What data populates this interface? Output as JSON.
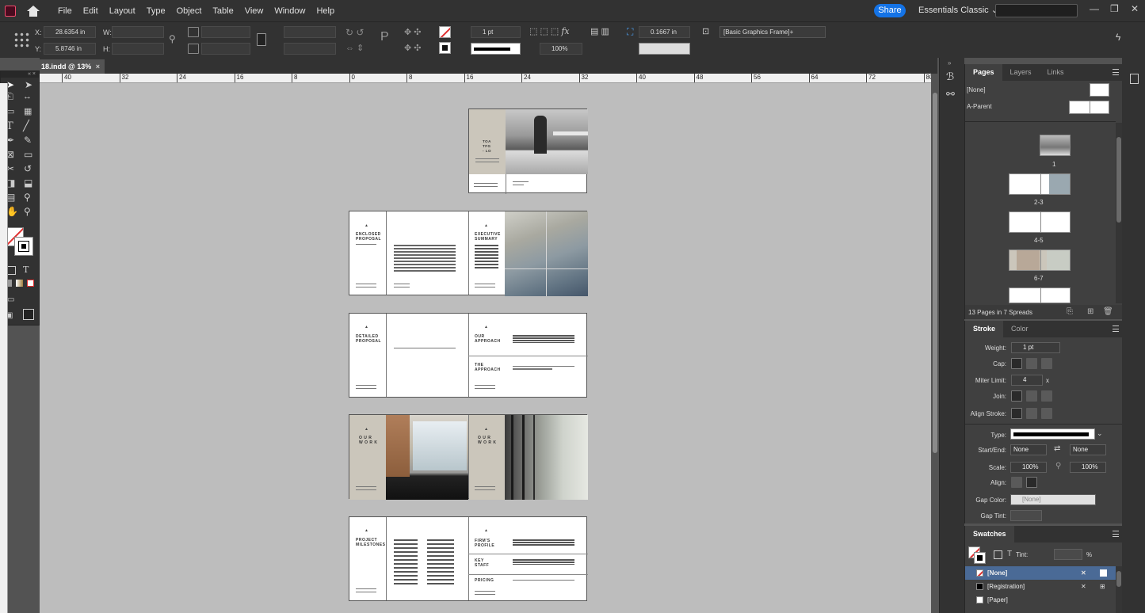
{
  "app": {
    "menu": [
      "File",
      "Edit",
      "Layout",
      "Type",
      "Object",
      "Table",
      "View",
      "Window",
      "Help"
    ],
    "share_label": "Share",
    "workspace_label": "Essentials Classic",
    "window_controls": [
      "—",
      "❐",
      "✕"
    ]
  },
  "control_panel": {
    "x_label": "X:",
    "x_value": "28.6354 in",
    "y_label": "Y:",
    "y_value": "5.8746 in",
    "w_label": "W:",
    "h_label": "H:",
    "stroke_weight": "1 pt",
    "scale_value": "100%",
    "offset_value": "0.1667 in",
    "object_style": "[Basic Graphics Frame]+"
  },
  "document": {
    "tab_label": "18.indd @ 13%",
    "tab_close": "×",
    "ruler_ticks": [
      "40",
      "32",
      "24",
      "16",
      "8",
      "0",
      "8",
      "16",
      "24",
      "32",
      "40",
      "48",
      "56",
      "64",
      "72",
      "80"
    ]
  },
  "spreads": {
    "cover_text": "TOA\nTFG\n- LO",
    "enclosed_proposal": "ENCLOSED\nPROPOSAL",
    "executive_summary": "EXECUTIVE\nSUMMARY",
    "detailed_proposal": "DETAILED\nPROPOSAL",
    "our_approach": "OUR\nAPPROACH",
    "the_approach": "THE\nAPPROACH",
    "our_work_left": "O U R\nW O R K",
    "our_work_right": "O U R\nW O R K",
    "project_milestones": "PROJECT\nMILESTONES",
    "firms_profile": "FIRM'S\nPROFILE",
    "key_staff": "KEY\nSTAFF",
    "pricing": "PRICING"
  },
  "pages_panel": {
    "tabs": [
      "Pages",
      "Layers",
      "Links"
    ],
    "none_label": "[None]",
    "parent_label": "A-Parent",
    "thumb_labels": [
      "1",
      "2-3",
      "4-5",
      "6-7"
    ],
    "footer": "13 Pages in 7 Spreads"
  },
  "stroke_panel": {
    "tabs": [
      "Stroke",
      "Color"
    ],
    "weight_label": "Weight:",
    "weight_value": "1 pt",
    "cap_label": "Cap:",
    "miter_label": "Miter Limit:",
    "miter_value": "4",
    "miter_unit": "x",
    "join_label": "Join:",
    "align_stroke_label": "Align Stroke:",
    "type_label": "Type:",
    "start_end_label": "Start/End:",
    "start_value": "None",
    "end_value": "None",
    "scale_label": "Scale:",
    "scale_start": "100%",
    "scale_end": "100%",
    "align_label": "Align:",
    "gap_color_label": "Gap Color:",
    "gap_color_value": "[None]",
    "gap_tint_label": "Gap Tint:"
  },
  "swatches_panel": {
    "title": "Swatches",
    "tint_label": "Tint:",
    "tint_unit": "%",
    "text_icon": "T",
    "items": [
      "[None]",
      "[Registration]",
      "[Paper]"
    ]
  },
  "colors": {
    "accent": "#1473e6",
    "selection": "#4a6a96",
    "canvas": "#bdbdbd"
  }
}
